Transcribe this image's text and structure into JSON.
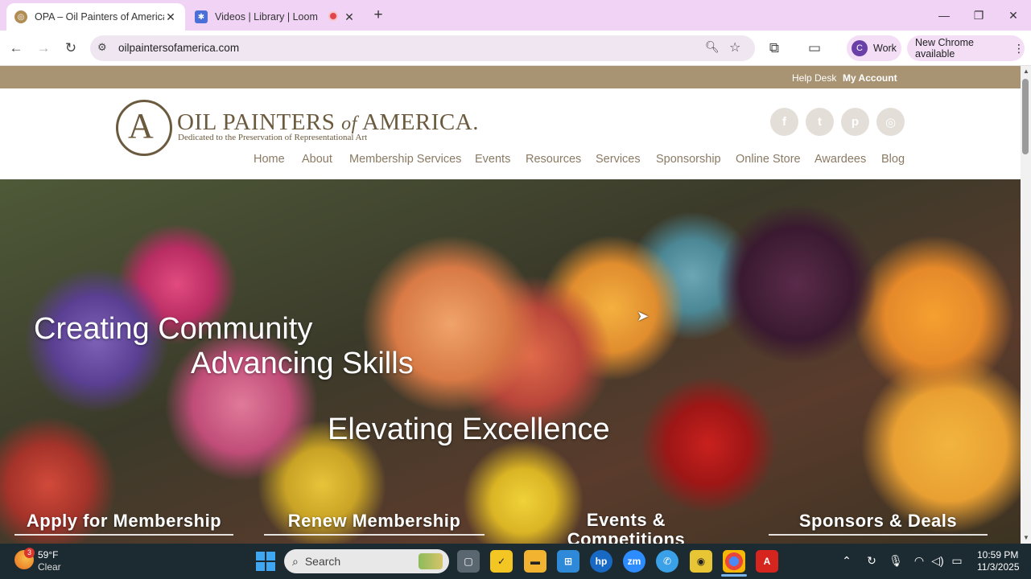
{
  "browser": {
    "tabs": [
      {
        "title": "OPA – Oil Painters of America –",
        "active": true
      },
      {
        "title": "Videos | Library | Loom",
        "active": false
      }
    ],
    "url": "oilpaintersofamerica.com",
    "profile_letter": "C",
    "profile_label": "Work",
    "update_label": "New Chrome available"
  },
  "site": {
    "topbar": {
      "help": "Help Desk",
      "account": "My Account"
    },
    "logo": {
      "name_part1": "OIL PAINTERS",
      "name_of": "of",
      "name_part2": "AMERICA",
      "name_dot": ".",
      "tagline": "Dedicated to the Preservation of Representational Art"
    },
    "nav": [
      "Home",
      "About",
      "Membership Services",
      "Events",
      "Resources",
      "Services",
      "Sponsorship",
      "Online Store",
      "Awardees",
      "Blog"
    ],
    "social_icons": [
      "facebook-icon",
      "twitter-icon",
      "pinterest-icon",
      "instagram-icon"
    ],
    "hero": {
      "line1": "Creating Community",
      "line2": "Advancing Skills",
      "line3": "Elevating Excellence"
    },
    "ctas": [
      "Apply for Membership",
      "Renew Membership",
      "Events & Competitions",
      "Sponsors & Deals"
    ]
  },
  "taskbar": {
    "weather_temp": "59°F",
    "weather_desc": "Clear",
    "weather_badge": "3",
    "search_placeholder": "Search",
    "time": "10:59 PM",
    "date": "11/3/2025"
  },
  "colors": {
    "tab_strip": "#f1d4f5",
    "site_topbar": "#a89372",
    "nav_text": "#8a7a63",
    "logo": "#6b5a3e"
  }
}
